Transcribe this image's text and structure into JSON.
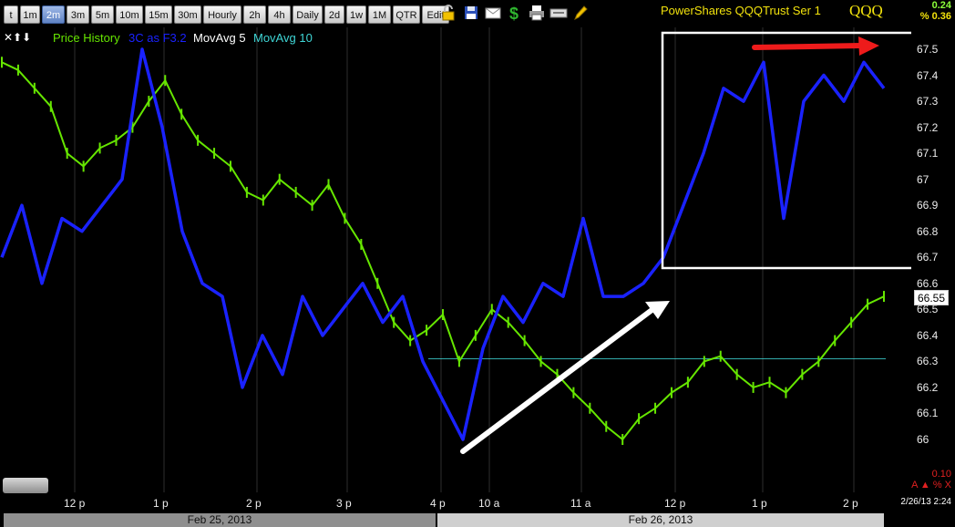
{
  "toolbar": {
    "buttons": [
      "t",
      "1m",
      "2m",
      "3m",
      "5m",
      "10m",
      "15m",
      "30m",
      "Hourly",
      "2h",
      "4h",
      "Daily",
      "2d",
      "1w",
      "1M",
      "QTR",
      "Edit"
    ],
    "active": "2m",
    "icons": [
      "lock-icon",
      "save-icon",
      "mail-icon",
      "dollar-icon",
      "print-icon",
      "keyboard-icon",
      "pencil-icon"
    ]
  },
  "header": {
    "title": "PowerShares QQQTrust Ser 1",
    "symbol": "QQQ",
    "change": "0.24",
    "pct_change": "% 0.36"
  },
  "legend": {
    "controls": "✕⬆⬇",
    "items": [
      "Price History",
      "3C as F3.2",
      "MovAvg 5",
      "MovAvg 10"
    ]
  },
  "lower_right": {
    "value": "0.10",
    "markers": "A ▲ % X",
    "timestamp": "2/26/13 2:24"
  },
  "colors": {
    "price": "#66e600",
    "indicator": "#1a22ff",
    "ma5": "#ffffff",
    "ma10": "#3fd6d6",
    "title": "#f2e20c"
  },
  "chart_data": {
    "type": "line",
    "title": "PowerShares QQQTrust Ser 1",
    "ylim": [
      65.9,
      67.6
    ],
    "y_ticks": [
      67.5,
      67.4,
      67.3,
      67.2,
      67.1,
      67.0,
      66.9,
      66.8,
      66.7,
      66.6,
      66.5,
      66.4,
      66.3,
      66.2,
      66.1,
      66.0
    ],
    "x_ticks": [
      "12 p",
      "1 p",
      "2 p",
      "3 p",
      "4 p",
      "10 a",
      "11 a",
      "12 p",
      "1 p",
      "2 p"
    ],
    "dates": [
      "Feb 25, 2013",
      "Feb 26, 2013"
    ],
    "last_price": "66.55",
    "reference_level": 66.31,
    "series": [
      {
        "name": "Price History",
        "values": [
          67.45,
          67.42,
          67.35,
          67.28,
          67.1,
          67.05,
          67.12,
          67.15,
          67.2,
          67.3,
          67.38,
          67.25,
          67.15,
          67.1,
          67.05,
          66.95,
          66.92,
          67.0,
          66.95,
          66.9,
          66.98,
          66.85,
          66.75,
          66.6,
          66.45,
          66.38,
          66.42,
          66.48,
          66.3,
          66.4,
          66.5,
          66.45,
          66.38,
          66.3,
          66.25,
          66.18,
          66.12,
          66.05,
          66.0,
          66.08,
          66.12,
          66.18,
          66.22,
          66.3,
          66.32,
          66.25,
          66.2,
          66.22,
          66.18,
          66.25,
          66.3,
          66.38,
          66.45,
          66.52,
          66.55
        ]
      },
      {
        "name": "3C as F3.2",
        "values": [
          66.7,
          66.9,
          66.6,
          66.85,
          66.8,
          66.9,
          67.0,
          67.5,
          67.2,
          66.8,
          66.6,
          66.55,
          66.2,
          66.4,
          66.25,
          66.55,
          66.4,
          66.5,
          66.6,
          66.45,
          66.55,
          66.3,
          66.15,
          66.0,
          66.35,
          66.55,
          66.45,
          66.6,
          66.55,
          66.85,
          66.55,
          66.55,
          66.6,
          66.7,
          66.9,
          67.1,
          67.35,
          67.3,
          67.45,
          66.85,
          67.3,
          67.4,
          67.3,
          67.45,
          67.35
        ]
      }
    ]
  }
}
